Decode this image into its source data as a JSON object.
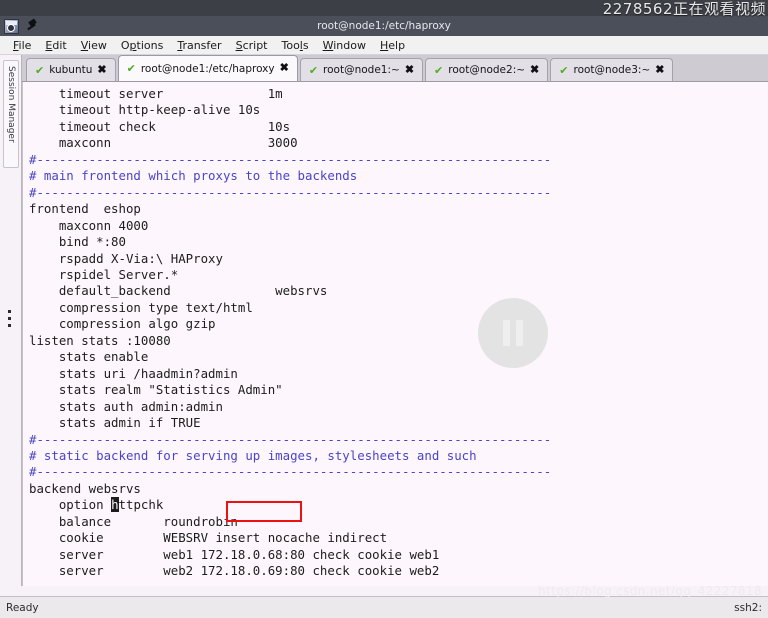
{
  "overlay": {
    "watching_label": "2278562正在观看视频",
    "pause_icon": "pause-icon",
    "watermark": "https://blog.csdn.net/qq_42227818"
  },
  "titlebar": {
    "title": "root@node1:/etc/haproxy",
    "app_icon": "securecrt-app-icon",
    "pin_icon": "pin-icon"
  },
  "menubar": {
    "items": [
      {
        "label": "File",
        "accel": "F",
        "rest": "ile"
      },
      {
        "label": "Edit",
        "accel": "E",
        "rest": "dit"
      },
      {
        "label": "View",
        "accel": "V",
        "rest": "iew"
      },
      {
        "label": "Options",
        "accel": "O",
        "rest": "ptions"
      },
      {
        "label": "Transfer",
        "accel": "T",
        "rest": "ransfer"
      },
      {
        "label": "Script",
        "accel": "S",
        "rest": "cript"
      },
      {
        "label": "Tools",
        "accel": "T",
        "rest": "ools"
      },
      {
        "label": "Window",
        "accel": "W",
        "rest": "indow"
      },
      {
        "label": "Help",
        "accel": "H",
        "rest": "elp"
      }
    ]
  },
  "sidebar": {
    "session_manager_label": "Session Manager"
  },
  "tabs": [
    {
      "label": "kubuntu",
      "active": false
    },
    {
      "label": "root@node1:/etc/haproxy",
      "active": true
    },
    {
      "label": "root@node1:~",
      "active": false
    },
    {
      "label": "root@node2:~",
      "active": false
    },
    {
      "label": "root@node3:~",
      "active": false
    }
  ],
  "tab_icons": {
    "check": "✔",
    "close": "✖"
  },
  "terminal": {
    "lines": [
      {
        "text": "    timeout server              1m",
        "style": "plain"
      },
      {
        "text": "    timeout http-keep-alive 10s",
        "style": "plain"
      },
      {
        "text": "    timeout check               10s",
        "style": "plain"
      },
      {
        "text": "    maxconn                     3000",
        "style": "plain"
      },
      {
        "text": "",
        "style": "plain"
      },
      {
        "text": "#---------------------------------------------------------------------",
        "style": "comment"
      },
      {
        "text": "# main frontend which proxys to the backends",
        "style": "comment"
      },
      {
        "text": "#---------------------------------------------------------------------",
        "style": "comment"
      },
      {
        "text": "frontend  eshop",
        "style": "plain"
      },
      {
        "text": "    maxconn 4000",
        "style": "plain"
      },
      {
        "text": "    bind *:80",
        "style": "plain"
      },
      {
        "text": "    rspadd X-Via:\\ HAProxy",
        "style": "plain"
      },
      {
        "text": "    rspidel Server.*",
        "style": "plain"
      },
      {
        "text": "    default_backend              websrvs",
        "style": "plain"
      },
      {
        "text": "    compression type text/html",
        "style": "plain"
      },
      {
        "text": "    compression algo gzip",
        "style": "plain"
      },
      {
        "text": "",
        "style": "plain"
      },
      {
        "text": "listen stats :10080",
        "style": "plain"
      },
      {
        "text": "    stats enable",
        "style": "plain"
      },
      {
        "text": "    stats uri /haadmin?admin",
        "style": "plain"
      },
      {
        "text": "    stats realm \"Statistics Admin\"",
        "style": "plain"
      },
      {
        "text": "    stats auth admin:admin",
        "style": "plain"
      },
      {
        "text": "    stats admin if TRUE",
        "style": "plain"
      },
      {
        "text": "#---------------------------------------------------------------------",
        "style": "comment"
      },
      {
        "text": "# static backend for serving up images, stylesheets and such",
        "style": "comment"
      },
      {
        "text": "#---------------------------------------------------------------------",
        "style": "comment"
      },
      {
        "text": "backend websrvs",
        "style": "plain"
      },
      {
        "text": "    option httpchk",
        "style": "cursor",
        "cursor_index": 11
      },
      {
        "text": "    balance       roundrobin",
        "style": "plain"
      },
      {
        "text": "    cookie        WEBSRV insert nocache indirect",
        "style": "plain"
      },
      {
        "text": "    server        web1 172.18.0.68:80 check cookie web1",
        "style": "plain"
      },
      {
        "text": "    server        web2 172.18.0.69:80 check cookie web2",
        "style": "plain"
      }
    ]
  },
  "annotation": {
    "red_box_label": "red-highlight-box"
  },
  "statusbar": {
    "left": "Ready",
    "right": "ssh2:"
  },
  "colors": {
    "comment_blue": "#4a44c7",
    "terminal_bg": "#fdf7fd",
    "titlebar_bg": "#4b4f5a",
    "annotation_red": "#ee1111",
    "tab_check_green": "#4fae22"
  }
}
